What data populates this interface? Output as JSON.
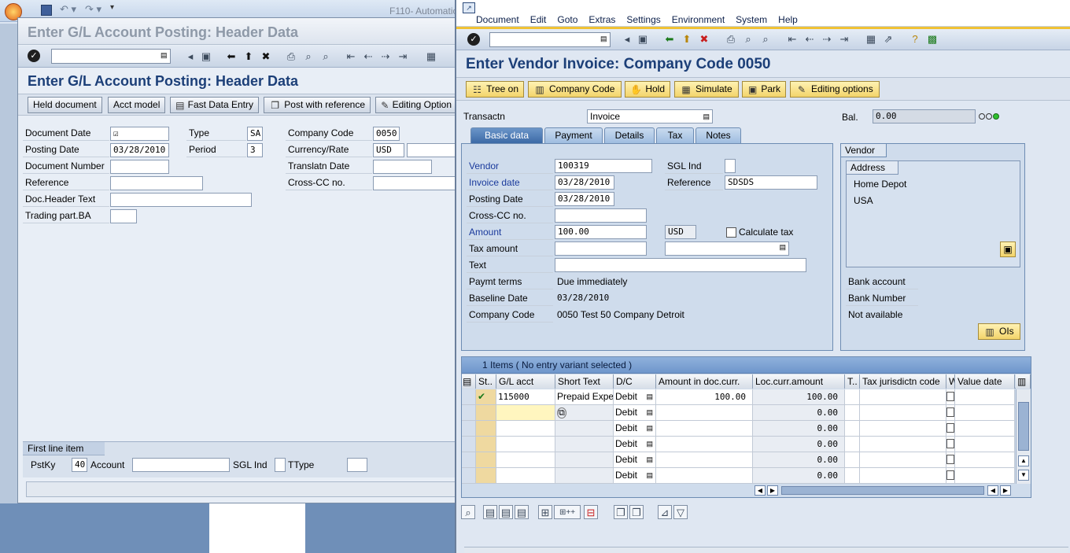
{
  "taskbar": {
    "title_text": "F110- Automatic"
  },
  "back_window": {
    "title": "Enter G/L Account Posting: Header Data",
    "heading": "Enter G/L Account Posting: Header Data",
    "buttons": [
      "Held document",
      "Acct model",
      "Fast Data Entry",
      "Post with reference",
      "Editing Option"
    ],
    "labels": {
      "doc_date": "Document Date",
      "posting_date": "Posting Date",
      "doc_number": "Document Number",
      "reference": "Reference",
      "doc_header_text": "Doc.Header Text",
      "trading_part": "Trading part.BA",
      "type": "Type",
      "period": "Period",
      "company_code": "Company Code",
      "currency_rate": "Currency/Rate",
      "translatn_date": "Translatn Date",
      "cross_cc": "Cross-CC no."
    },
    "values": {
      "posting_date": "03/28/2010",
      "type": "SA",
      "period": "3",
      "company_code": "0050",
      "currency": "USD"
    },
    "first_line": {
      "title": "First line item",
      "pstky_label": "PstKy",
      "pstky_value": "40",
      "account_label": "Account",
      "sgl_label": "SGL Ind",
      "ttype_label": "TType"
    }
  },
  "menu": [
    "Document",
    "Edit",
    "Goto",
    "Extras",
    "Settings",
    "Environment",
    "System",
    "Help"
  ],
  "front": {
    "title": "Enter Vendor Invoice: Company Code 0050",
    "app_buttons": [
      {
        "label": "Tree on",
        "icon": "tree-icon"
      },
      {
        "label": "Company Code",
        "icon": "company-icon"
      },
      {
        "label": "Hold",
        "icon": "hold-icon"
      },
      {
        "label": "Simulate",
        "icon": "simulate-icon"
      },
      {
        "label": "Park",
        "icon": "park-icon"
      },
      {
        "label": "Editing options",
        "icon": "pencil-icon"
      }
    ],
    "transactn_label": "Transactn",
    "transactn_value": "Invoice",
    "bal_label": "Bal.",
    "bal_value": "0.00",
    "tabs": [
      "Basic data",
      "Payment",
      "Details",
      "Tax",
      "Notes"
    ],
    "basic": {
      "vendor_label": "Vendor",
      "vendor_value": "100319",
      "invoice_date_label": "Invoice date",
      "invoice_date_value": "03/28/2010",
      "posting_date_label": "Posting Date",
      "posting_date_value": "03/28/2010",
      "cross_cc_label": "Cross-CC no.",
      "amount_label": "Amount",
      "amount_value": "100.00",
      "currency": "USD",
      "calc_tax_label": "Calculate tax",
      "tax_amount_label": "Tax amount",
      "text_label": "Text",
      "paymt_terms_label": "Paymt terms",
      "paymt_terms_value": "Due immediately",
      "baseline_label": "Baseline Date",
      "baseline_value": "03/28/2010",
      "company_code_label": "Company Code",
      "company_code_value": "0050 Test 50 Company Detroit",
      "sgl_label": "SGL Ind",
      "reference_label": "Reference",
      "reference_value": "SDSDS"
    },
    "vendor_panel": {
      "title": "Vendor",
      "address_title": "Address",
      "name": "Home Depot",
      "country": "USA",
      "bank_account": "Bank account",
      "bank_number": "Bank Number",
      "not_available": "Not available",
      "ois_button": "OIs"
    },
    "items": {
      "header": "1 Items ( No entry variant selected )",
      "columns": [
        "St..",
        "G/L acct",
        "Short Text",
        "D/C",
        "Amount in doc.curr.",
        "Loc.curr.amount",
        "T..",
        "Tax jurisdictn code",
        "W",
        "Value date"
      ],
      "rows": [
        {
          "gl": "115000",
          "short_text": "Prepaid Expe",
          "dc": "Debit",
          "amount": "100.00",
          "loc": "100.00"
        },
        {
          "gl": "",
          "short_text": "",
          "dc": "Debit",
          "amount": "",
          "loc": "0.00"
        },
        {
          "gl": "",
          "short_text": "",
          "dc": "Debit",
          "amount": "",
          "loc": "0.00"
        },
        {
          "gl": "",
          "short_text": "",
          "dc": "Debit",
          "amount": "",
          "loc": "0.00"
        },
        {
          "gl": "",
          "short_text": "",
          "dc": "Debit",
          "amount": "",
          "loc": "0.00"
        },
        {
          "gl": "",
          "short_text": "",
          "dc": "Debit",
          "amount": "",
          "loc": "0.00"
        }
      ]
    }
  }
}
